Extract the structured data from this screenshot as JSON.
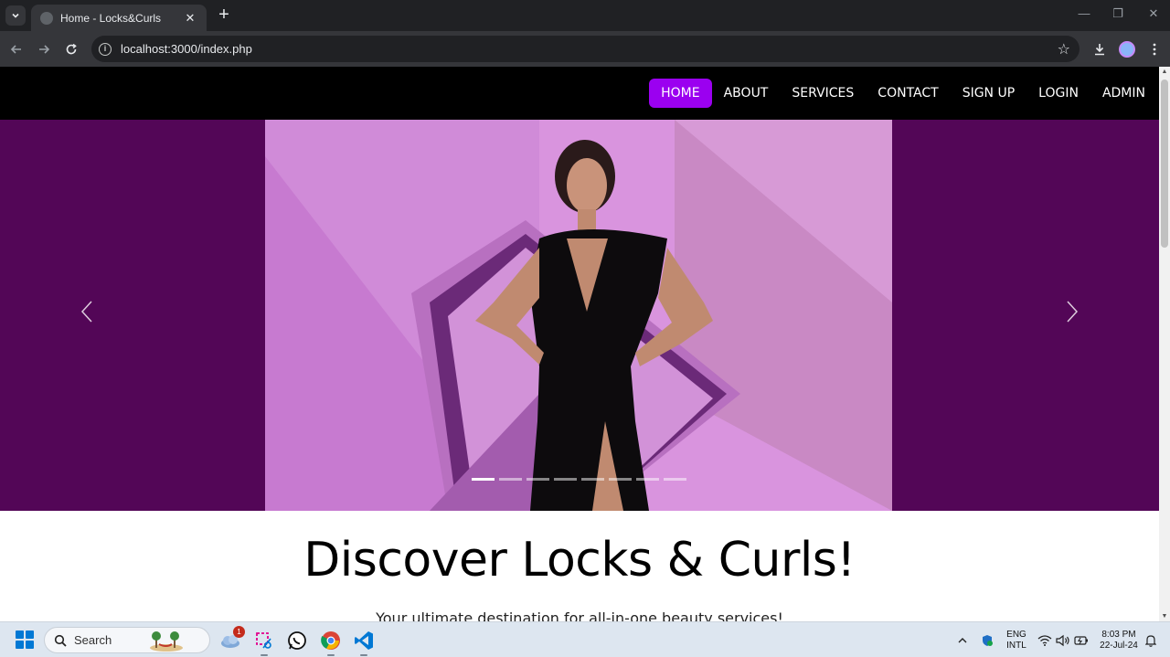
{
  "browser": {
    "tab_title": "Home - Locks&Curls",
    "url": "localhost:3000/index.php",
    "new_tab": "+",
    "close": "✕",
    "minimize": "—",
    "restore": "❐",
    "window_close": "✕"
  },
  "nav": {
    "links": [
      "HOME",
      "ABOUT",
      "SERVICES",
      "CONTACT",
      "SIGN UP",
      "LOGIN",
      "ADMIN"
    ],
    "active": "HOME"
  },
  "hero": {
    "slide_count": 8,
    "active_slide": 1,
    "background": "#530657",
    "image_bg": "#d590da"
  },
  "content": {
    "headline": "Discover Locks & Curls!",
    "subline": "Your ultimate destination for all-in-one beauty services!"
  },
  "taskbar": {
    "search_label": "Search",
    "weather_badge": "1",
    "lang_top": "ENG",
    "lang_bottom": "INTL",
    "time": "8:03 PM",
    "date": "22-Jul-24"
  },
  "colors": {
    "accent": "#9b00f0",
    "nav_bg": "#000000"
  }
}
